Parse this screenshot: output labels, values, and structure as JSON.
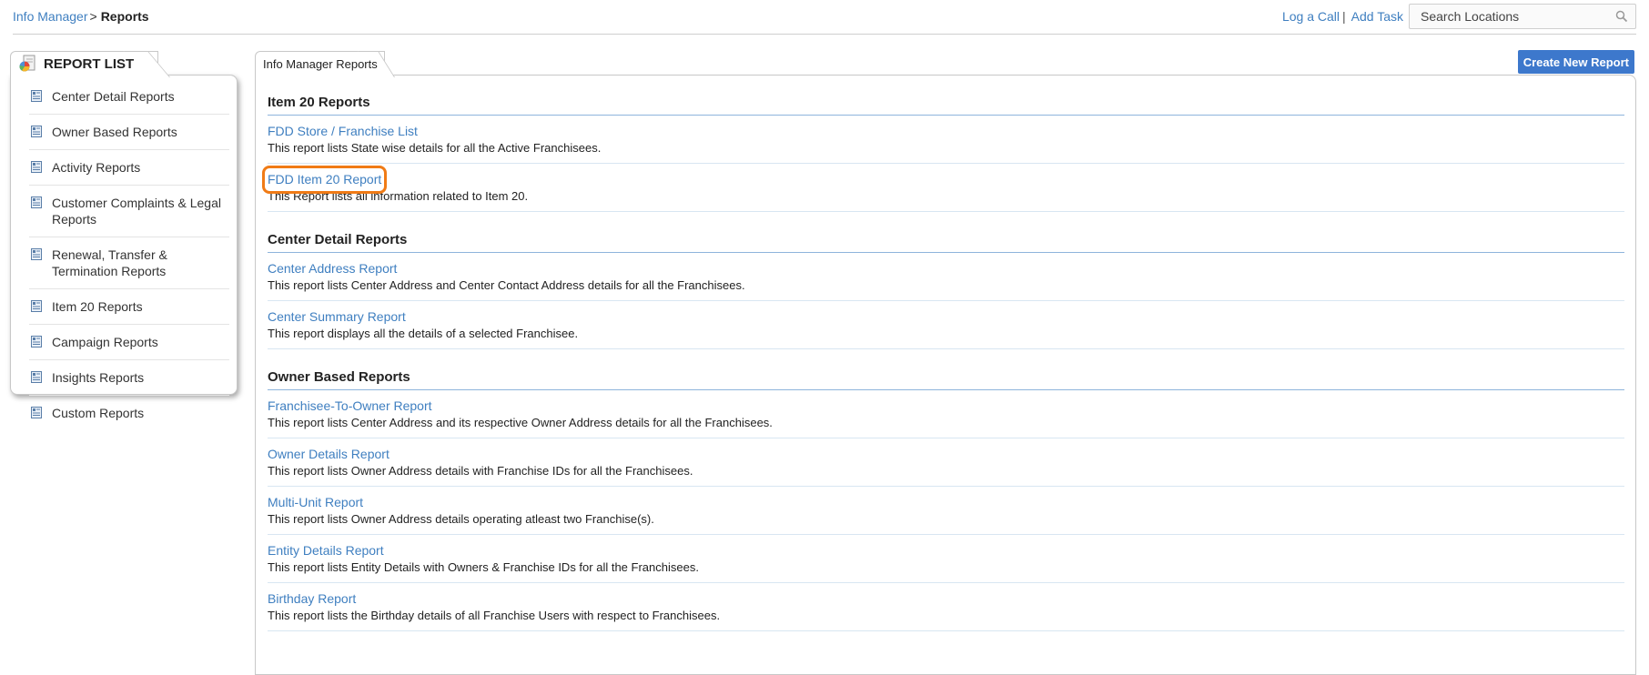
{
  "breadcrumb": {
    "parent": "Info Manager",
    "separator": ">",
    "current": "Reports"
  },
  "top_actions": {
    "log_call": "Log a Call",
    "separator": "|",
    "add_task": "Add Task",
    "search_placeholder": "Search Locations"
  },
  "left_panel": {
    "tab_title": "REPORT LIST",
    "items": [
      {
        "label": "Center Detail Reports"
      },
      {
        "label": "Owner Based Reports"
      },
      {
        "label": "Activity Reports"
      },
      {
        "label": "Customer Complaints & Legal Reports"
      },
      {
        "label": "Renewal, Transfer & Termination Reports"
      },
      {
        "label": "Item 20 Reports"
      },
      {
        "label": "Campaign Reports"
      },
      {
        "label": "Insights Reports"
      },
      {
        "label": "Custom Reports"
      }
    ]
  },
  "main_panel": {
    "tab_title": "Info Manager Reports",
    "create_button": "Create New Report",
    "highlight_color": "#f07b16",
    "sections": [
      {
        "heading": "Item 20 Reports",
        "entries": [
          {
            "title": "FDD Store / Franchise List",
            "description": "This report lists State wise details for all the Active Franchisees."
          },
          {
            "title": "FDD Item 20 Report",
            "description": "This Report lists all information related to Item 20.",
            "highlighted": true
          }
        ]
      },
      {
        "heading": "Center Detail Reports",
        "entries": [
          {
            "title": "Center Address Report",
            "description": "This report lists Center Address and Center Contact Address details for all the Franchisees."
          },
          {
            "title": "Center Summary Report",
            "description": "This report displays all the details of a selected Franchisee."
          }
        ]
      },
      {
        "heading": "Owner Based Reports",
        "entries": [
          {
            "title": "Franchisee-To-Owner Report",
            "description": "This report lists Center Address and its respective Owner Address details for all the Franchisees."
          },
          {
            "title": "Owner Details Report",
            "description": "This report lists Owner Address details with Franchise IDs for all the Franchisees."
          },
          {
            "title": "Multi-Unit Report",
            "description": "This report lists Owner Address details operating atleast two Franchise(s)."
          },
          {
            "title": "Entity Details Report",
            "description": "This report lists Entity Details with Owners & Franchise IDs for all the Franchisees."
          },
          {
            "title": "Birthday Report",
            "description": "This report lists the Birthday details of all Franchise Users with respect to Franchisees."
          }
        ]
      }
    ]
  }
}
